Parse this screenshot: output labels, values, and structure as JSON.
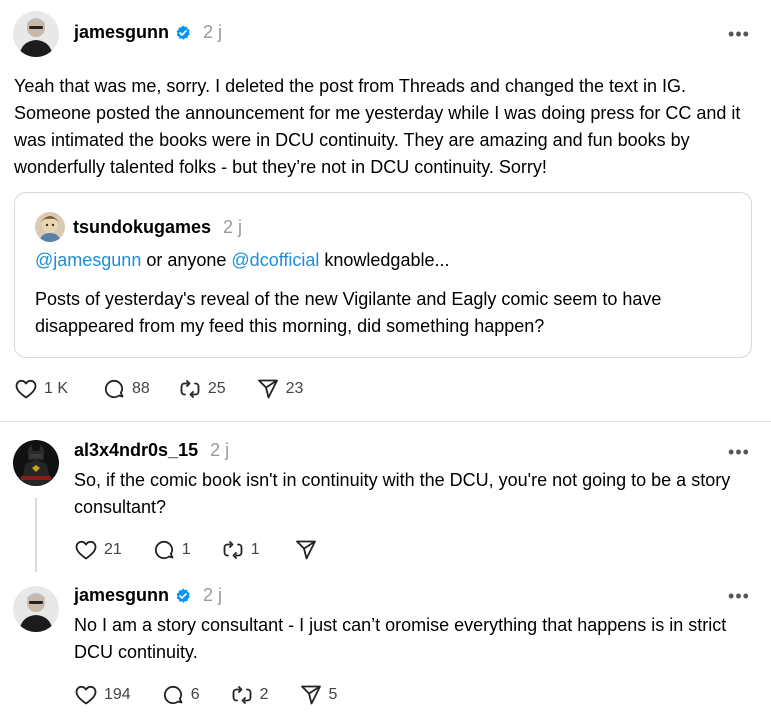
{
  "post": {
    "username": "jamesgunn",
    "time": "2 j",
    "text": "Yeah that was me, sorry. I deleted the post from Threads and changed the text in IG. Someone posted the announcement for me yesterday while I was doing press for CC and it was intimated the books were in DCU continuity. They are amazing and fun books by wonderfully talented folks - but they’re not in DCU continuity. Sorry!",
    "quote": {
      "username": "tsundokugames",
      "time": "2 j",
      "mention1": "@jamesgunn",
      "mid": " or anyone ",
      "mention2": "@dcofficial",
      "tail": " knowledgable...",
      "text": "Posts of yesterday's reveal of the new Vigilante and Eagly comic seem to have disappeared from my feed this morning, did something happen?"
    },
    "stats": {
      "likes": "1 K",
      "replies": "88",
      "reposts": "25",
      "shares": "23"
    }
  },
  "reply1": {
    "username": "al3x4ndr0s_15",
    "time": "2 j",
    "text": "So, if the comic book isn't in continuity with the DCU, you're not going to be a story consultant?",
    "stats": {
      "likes": "21",
      "replies": "1",
      "reposts": "1"
    }
  },
  "reply2": {
    "username": "jamesgunn",
    "time": "2 j",
    "text": "No I am a story consultant - I just can’t oromise everything that happens is in strict DCU continuity.",
    "stats": {
      "likes": "194",
      "replies": "6",
      "reposts": "2",
      "shares": "5"
    }
  },
  "icons": {
    "more": "more-icon",
    "verified": "verified-badge-icon",
    "like": "heart-icon",
    "reply": "comment-icon",
    "repost": "repost-icon",
    "share": "send-icon"
  },
  "colors": {
    "link": "#1d8ed8",
    "verified": "#0095f6",
    "muted": "#999999"
  }
}
